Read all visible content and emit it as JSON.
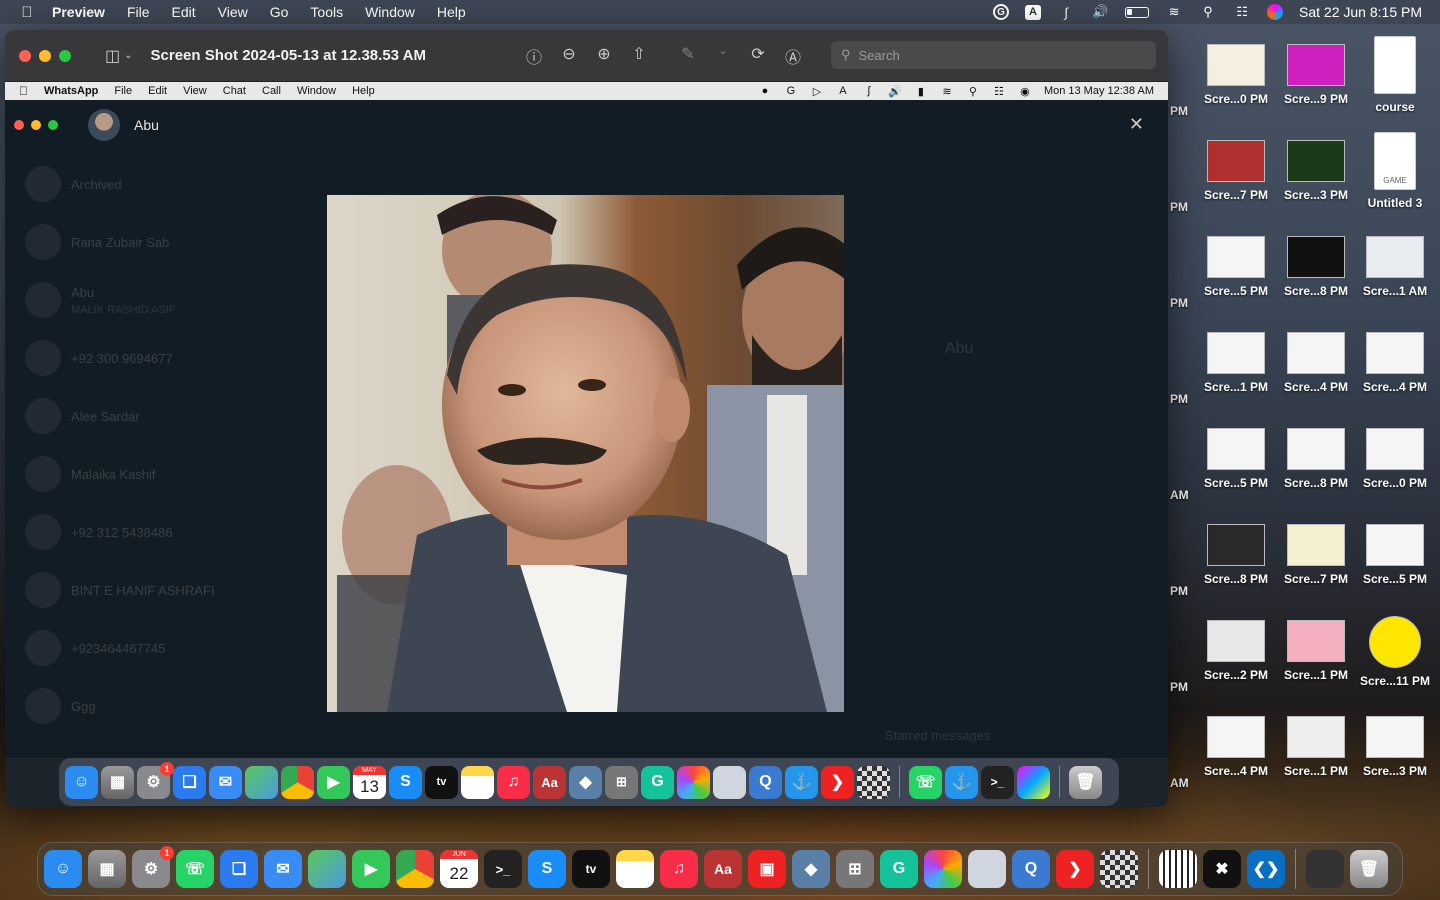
{
  "menubar": {
    "app": "Preview",
    "items": [
      "File",
      "Edit",
      "View",
      "Go",
      "Tools",
      "Window",
      "Help"
    ],
    "datetime": "Sat 22 Jun  8:15 PM"
  },
  "preview": {
    "title": "Screen Shot 2024-05-13 at 12.38.53 AM",
    "search_placeholder": "Search"
  },
  "inner_menubar": {
    "app": "WhatsApp",
    "items": [
      "File",
      "Edit",
      "View",
      "Chat",
      "Call",
      "Window",
      "Help"
    ],
    "datetime": "Mon 13 May  12:38 AM"
  },
  "whatsapp": {
    "contact_name": "Abu",
    "chats": [
      {
        "name": "Archived",
        "sub": ""
      },
      {
        "name": "Rana Zubair Sab",
        "sub": ""
      },
      {
        "name": "Abu",
        "sub": "MALIK RASHID ASIF"
      },
      {
        "name": "+92 300 9694677",
        "sub": ""
      },
      {
        "name": "Alee Sardar",
        "sub": ""
      },
      {
        "name": "Malaika Kashif",
        "sub": ""
      },
      {
        "name": "+92 312 5438486",
        "sub": ""
      },
      {
        "name": "BINT E HANIF ASHRAFI",
        "sub": ""
      },
      {
        "name": "+923464467745",
        "sub": ""
      },
      {
        "name": "Ggg",
        "sub": ""
      }
    ],
    "profile_name": "Abu",
    "starred": "Starred messages"
  },
  "inner_dock": {
    "calendar": {
      "month": "MAY",
      "day": "13"
    },
    "badge": "1"
  },
  "dock": {
    "calendar": {
      "month": "JUN",
      "day": "22"
    },
    "badge": "1"
  },
  "desktop": {
    "icons": [
      {
        "label": "Scre...0 PM"
      },
      {
        "label": "Scre...9 PM"
      },
      {
        "label": "course"
      },
      {
        "label": "Scre...7 PM"
      },
      {
        "label": "Scre...3 PM"
      },
      {
        "label": "Untitled 3",
        "thumb": "GAME"
      },
      {
        "label": "Scre...5 PM"
      },
      {
        "label": "Scre...8 PM"
      },
      {
        "label": "Scre...1 AM"
      },
      {
        "label": "Scre...1 PM"
      },
      {
        "label": "Scre...4 PM"
      },
      {
        "label": "Scre...4 PM"
      },
      {
        "label": "Scre...5 PM"
      },
      {
        "label": "Scre...8 PM"
      },
      {
        "label": "Scre...0 PM"
      },
      {
        "label": "Scre...8 PM"
      },
      {
        "label": "Scre...7 PM"
      },
      {
        "label": "Scre...5 PM"
      },
      {
        "label": "Scre...2 PM"
      },
      {
        "label": "Scre...1 PM"
      },
      {
        "label": "Scre...11 PM"
      },
      {
        "label": "Scre...4 PM"
      },
      {
        "label": "Scre...1 PM"
      },
      {
        "label": "Scre...3 PM"
      }
    ],
    "partial_labels": [
      "PM",
      "PM",
      "PM",
      "PM",
      "AM",
      "PM",
      "PM",
      "AM"
    ]
  },
  "colors": {
    "traffic_red": "#fe5f57",
    "traffic_yellow": "#febc2e",
    "traffic_green": "#28c840",
    "whatsapp_bg": "#121c24"
  }
}
